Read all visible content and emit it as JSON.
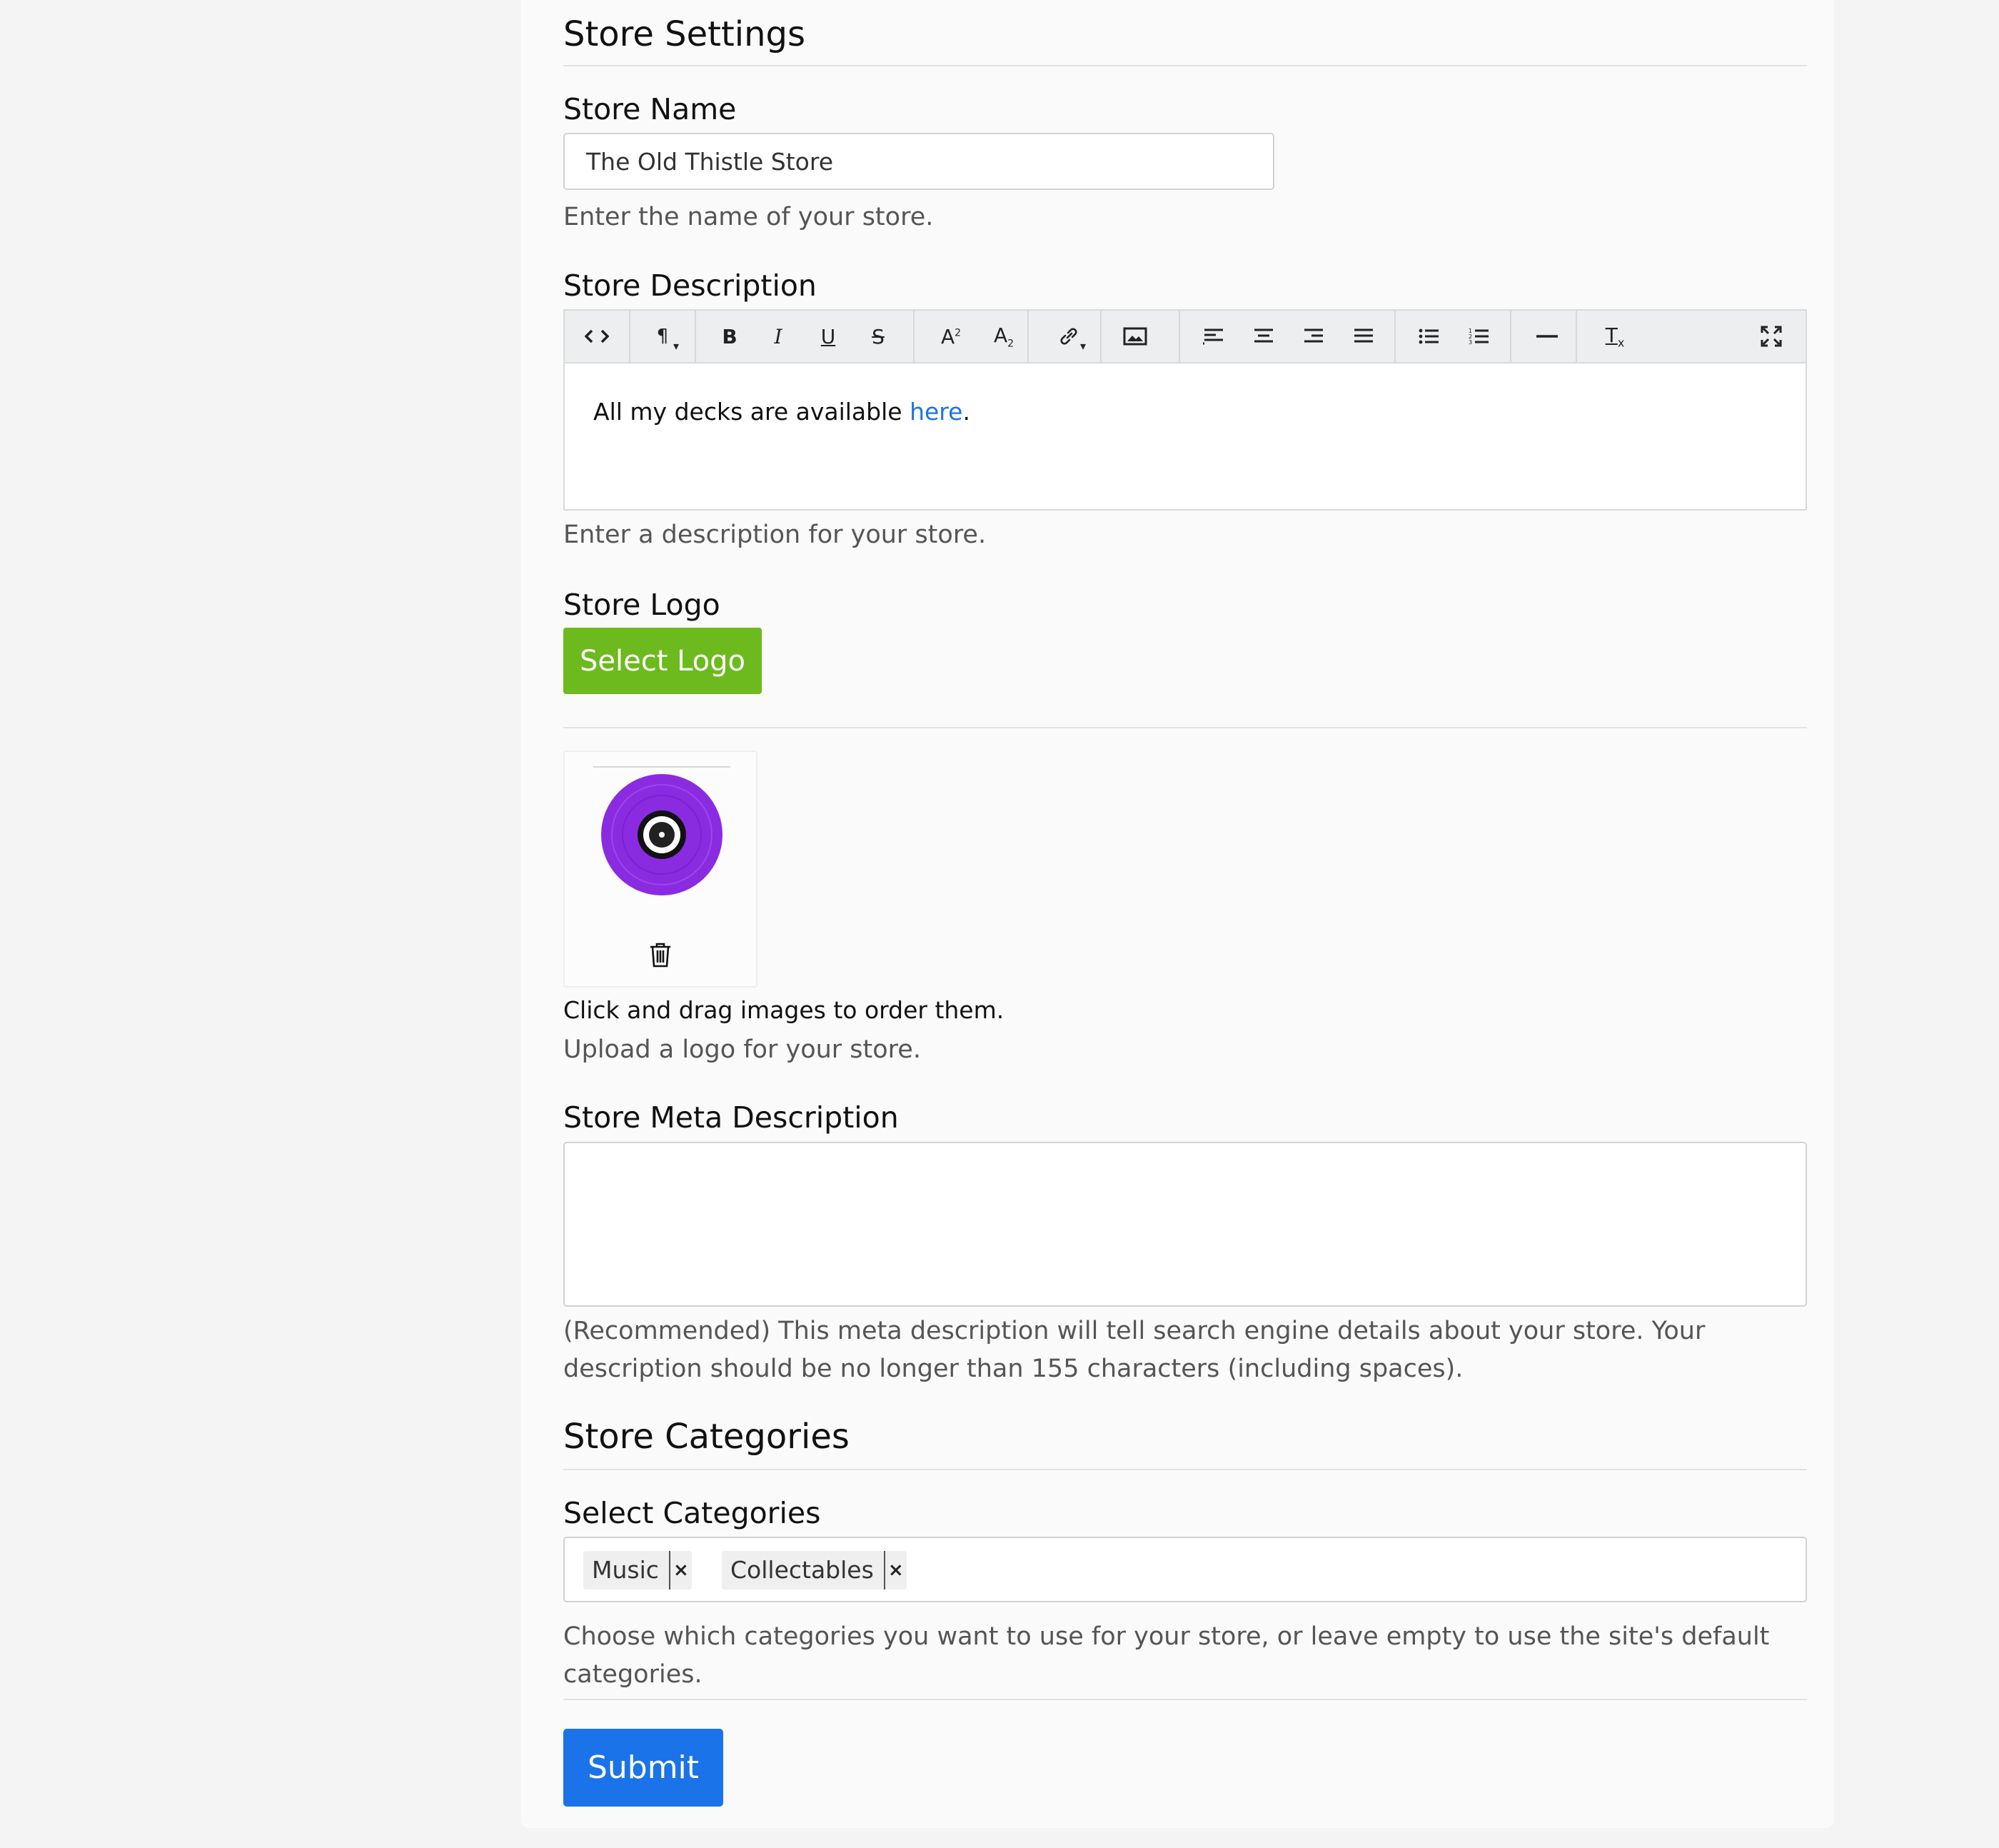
{
  "store_settings": {
    "title": "Store Settings",
    "name": {
      "label": "Store Name",
      "value": "The Old Thistle Store",
      "help": "Enter the name of your store."
    },
    "description": {
      "label": "Store Description",
      "content_text": "All my decks are available ",
      "content_link": "here",
      "content_end": ".",
      "help": "Enter a description for your store.",
      "toolbar": [
        "code-view",
        "paragraph-format",
        "bold",
        "italic",
        "underline",
        "strikethrough",
        "superscript",
        "subscript",
        "insert-link",
        "insert-image",
        "align-left",
        "align-center",
        "align-right",
        "align-justify",
        "bullet-list",
        "numbered-list",
        "horizontal-rule",
        "clear-formatting",
        "fullscreen"
      ]
    },
    "logo": {
      "label": "Store Logo",
      "select_label": "Select Logo",
      "drag_note": "Click and drag images to order them.",
      "help": "Upload a logo for your store.",
      "image_color": "#8a2be2"
    },
    "meta": {
      "label": "Store Meta Description",
      "value": "",
      "help": "(Recommended) This meta description will tell search engine details about your store. Your description should be no longer than 155 characters (including spaces)."
    }
  },
  "categories": {
    "title": "Store Categories",
    "label": "Select Categories",
    "tags": [
      "Music",
      "Collectables"
    ],
    "remove_glyph": "×",
    "help": "Choose which categories you want to use for your store, or leave empty to use the site's default categories."
  },
  "submit_label": "Submit",
  "colors": {
    "primary": "#1a73e8",
    "success": "#6cba1d",
    "link": "#1a73e8"
  }
}
